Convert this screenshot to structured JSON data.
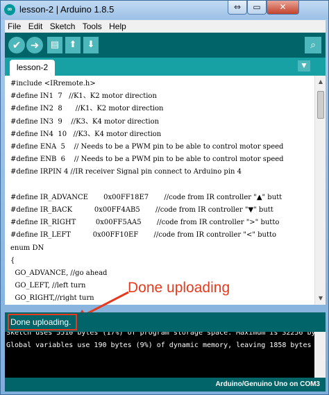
{
  "window": {
    "title": "lesson-2 | Arduino 1.8.5",
    "app_icon": "arduino-icon",
    "min_glyph": "⇔",
    "max_glyph": "▭",
    "close_glyph": "✕"
  },
  "menu": [
    "File",
    "Edit",
    "Sketch",
    "Tools",
    "Help"
  ],
  "toolbar": {
    "verify_icon": "✔",
    "upload_icon": "➜",
    "new_icon": "▤",
    "open_icon": "⬆",
    "save_icon": "⬇",
    "serial_icon": "⌕"
  },
  "tabs": {
    "active": "lesson-2",
    "menu_glyph": "▼"
  },
  "code": [
    "#include <IRremote.h>",
    "#define IN1  7   //K1、K2 motor direction",
    "#define IN2  8      //K1、K2 motor direction",
    "#define IN3  9    //K3、K4 motor direction",
    "#define IN4  10   //K3、K4 motor direction",
    "#define ENA  5    // Needs to be a PWM pin to be able to control motor speed",
    "#define ENB  6    // Needs to be a PWM pin to be able to control motor speed",
    "#define IRPIN 4 //IR receiver Signal pin connect to Arduino pin 4",
    "",
    "#define IR_ADVANCE       0x00FF18E7       //code from IR controller \"▲\" butt",
    "#define IR_BACK          0x00FF4AB5       //code from IR controller \"▼\" butt",
    "#define IR_RIGHT         0x00FF5AA5       //code from IR controller \">\" butto",
    "#define IR_LEFT          0x00FF10EF       //code from IR controller \"<\" butto",
    "enum DN",
    "{",
    "  GO_ADVANCE, //go ahead",
    "  GO_LEFT, //left turn",
    "  GO_RIGHT,//right turn"
  ],
  "annotation": {
    "label": "Done uploading"
  },
  "status": {
    "message": "Done uploading."
  },
  "console": [
    "Sketch uses 5510 bytes (17%) of program storage space. Maximum is 32256 bytes.",
    "Global variables use 190 bytes (9%) of dynamic memory, leaving 1858 bytes for"
  ],
  "footer": {
    "board": "Arduino/Genuino Uno on COM3"
  },
  "colors": {
    "accent": "#006468",
    "tab_bar": "#17a1a5",
    "annotation": "#e53a1e"
  }
}
